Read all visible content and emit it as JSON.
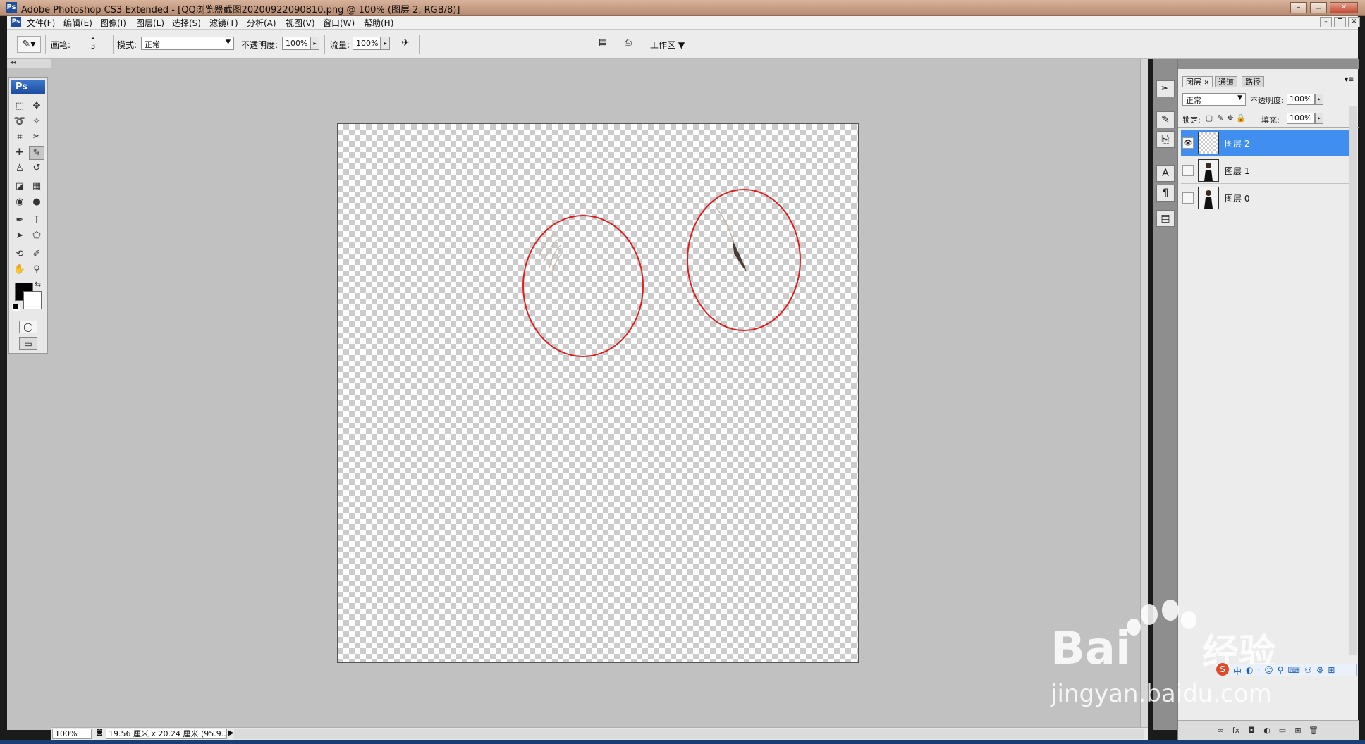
{
  "window": {
    "title": "Adobe Photoshop CS3 Extended - [QQ浏览器截图20200922090810.png @ 100% (图层 2, RGB/8)]",
    "app_icon": "Ps",
    "buttons": {
      "minimize": "–",
      "restore": "❐",
      "close": "✕"
    },
    "mdi_buttons": {
      "minimize": "–",
      "restore": "❐",
      "close": "✕"
    }
  },
  "menu": {
    "icon": "Ps",
    "items": [
      "文件(F)",
      "编辑(E)",
      "图像(I)",
      "图层(L)",
      "选择(S)",
      "滤镜(T)",
      "分析(A)",
      "视图(V)",
      "窗口(W)",
      "帮助(H)"
    ]
  },
  "options": {
    "brush_label": "画笔:",
    "brush_size": "3",
    "mode_label": "模式:",
    "mode_value": "正常",
    "opacity_label": "不透明度:",
    "opacity_value": "100%",
    "flow_label": "流量:",
    "flow_value": "100%",
    "workspace_label": "工作区 ▼"
  },
  "toolbox": {
    "logo": "Ps",
    "tools": [
      {
        "icon": "marquee-icon",
        "glyph": "⬚"
      },
      {
        "icon": "move-icon",
        "glyph": "✥"
      },
      {
        "icon": "lasso-icon",
        "glyph": "➰"
      },
      {
        "icon": "magic-wand-icon",
        "glyph": "✧"
      },
      {
        "icon": "crop-icon",
        "glyph": "⌗"
      },
      {
        "icon": "slice-icon",
        "glyph": "✂"
      },
      {
        "icon": "healing-icon",
        "glyph": "✚"
      },
      {
        "icon": "brush-icon",
        "glyph": "✎",
        "active": true
      },
      {
        "icon": "stamp-icon",
        "glyph": "♙"
      },
      {
        "icon": "history-brush-icon",
        "glyph": "↺"
      },
      {
        "icon": "eraser-icon",
        "glyph": "◪"
      },
      {
        "icon": "gradient-icon",
        "glyph": "▦"
      },
      {
        "icon": "blur-icon",
        "glyph": "◉"
      },
      {
        "icon": "dodge-icon",
        "glyph": "●"
      },
      {
        "icon": "pen-icon",
        "glyph": "✒"
      },
      {
        "icon": "type-icon",
        "glyph": "T"
      },
      {
        "icon": "path-select-icon",
        "glyph": "➤"
      },
      {
        "icon": "shape-icon",
        "glyph": "⬠"
      },
      {
        "icon": "3d-rotate-icon",
        "glyph": "⟲"
      },
      {
        "icon": "eyedropper-icon",
        "glyph": "✐"
      },
      {
        "icon": "hand-icon",
        "glyph": "✋"
      },
      {
        "icon": "zoom-icon",
        "glyph": "⚲"
      }
    ],
    "foreground_color": "#000000",
    "background_color": "#ffffff",
    "quick_mask_icon": "◯",
    "screen_mode_icon": "▭"
  },
  "canvas": {
    "annotation_color": "#e21b1b"
  },
  "status": {
    "zoom": "100%",
    "doc_info": "19.56 厘米 x 20.24 厘米 (95.9..."
  },
  "dock": {
    "icons": [
      "tools-preset-icon",
      "brush-preset-icon",
      "clone-source-icon",
      "character-icon",
      "paragraph-icon",
      "layer-comps-icon"
    ],
    "glyphs": [
      "✂",
      "✎",
      "⎘",
      "A",
      "¶",
      "▤"
    ]
  },
  "layers_panel": {
    "tabs": [
      "图层",
      "通道",
      "路径"
    ],
    "tab_close": "✕",
    "blend_mode": "正常",
    "opacity_label": "不透明度:",
    "opacity_value": "100%",
    "lock_label": "锁定:",
    "fill_label": "填充:",
    "fill_value": "100%",
    "layers": [
      {
        "name": "图层 2",
        "selected": true,
        "visible": true,
        "thumb": "transparent"
      },
      {
        "name": "图层 1",
        "selected": false,
        "visible": false,
        "thumb": "person"
      },
      {
        "name": "图层 0",
        "selected": false,
        "visible": false,
        "thumb": "person"
      }
    ],
    "bottom_icons": [
      "link-icon",
      "fx-icon",
      "mask-icon",
      "adjustment-icon",
      "group-icon",
      "new-layer-icon",
      "delete-icon"
    ],
    "bottom_glyphs": [
      "∞",
      "fx",
      "◘",
      "◐",
      "▭",
      "⊞",
      "🗑"
    ]
  },
  "watermark": {
    "brand": "Bai",
    "suffix": "经验",
    "url": "jingyan.baidu.com"
  },
  "ime": {
    "label": "中"
  }
}
